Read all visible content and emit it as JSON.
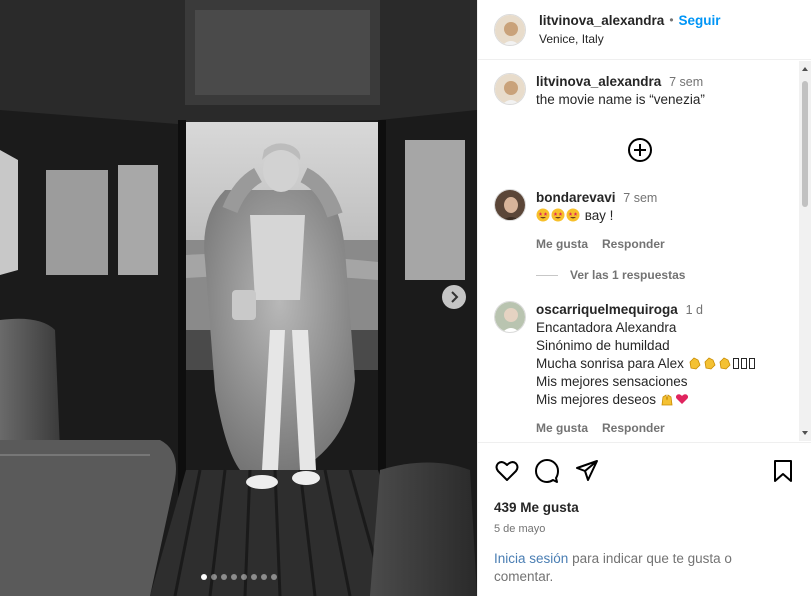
{
  "post": {
    "username": "litvinova_alexandra",
    "separator": "•",
    "follow_label": "Seguir",
    "location": "Venice, Italy"
  },
  "caption": {
    "username": "litvinova_alexandra",
    "time": "7 sem",
    "text": "the movie name is “venezia”"
  },
  "comments": [
    {
      "username": "bondarevavi",
      "time": "7 sem",
      "text": "вау !",
      "emojis": [
        "star-struck-emoji",
        "star-struck-emoji",
        "star-struck-emoji"
      ],
      "like_label": "Me gusta",
      "reply_label": "Responder"
    },
    {
      "username": "oscarriquelmequiroga",
      "time": "1 d",
      "lines": [
        "Encantadora Alexandra",
        "Sinónimo de humildad",
        "Mucha sonrisa para Alex",
        "Mis mejores sensaciones",
        "Mis mejores deseos"
      ],
      "like_label": "Me gusta",
      "reply_label": "Responder"
    }
  ],
  "view_replies_label": "Ver las 1 respuestas",
  "likes": "439 Me gusta",
  "date": "5 de mayo",
  "login_prompt": {
    "link": "Inicia sesión",
    "rest": "para indicar que te gusta o comentar."
  },
  "icons": {
    "like": "heart-icon",
    "comment": "comment-icon",
    "share": "share-icon",
    "save": "bookmark-icon",
    "next": "chevron-right-icon",
    "load_more": "plus-circle-icon"
  },
  "colors": {
    "accent": "#0095f6",
    "muted": "#737373",
    "heart_emoji": "#e0245e"
  },
  "carousel": {
    "slides": 8,
    "active_index": 0
  }
}
